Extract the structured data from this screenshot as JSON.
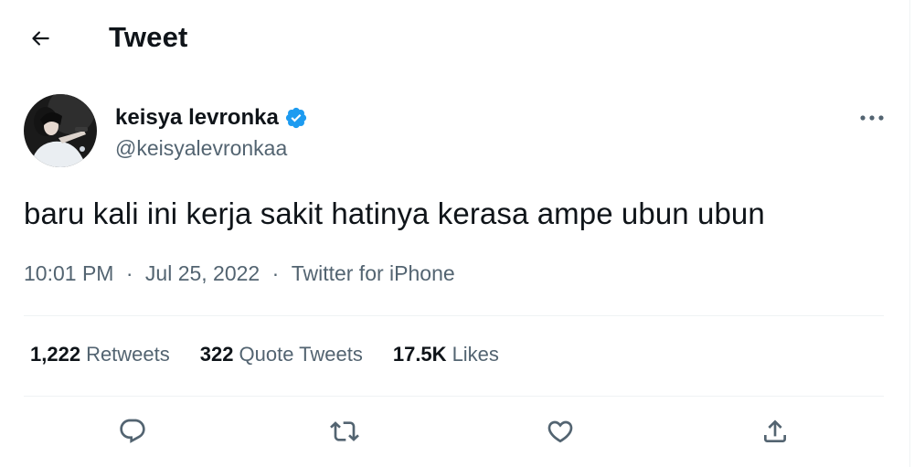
{
  "header": {
    "title": "Tweet",
    "back_icon": "arrow-left-icon"
  },
  "author": {
    "display_name": "keisya levronka",
    "handle": "@keisyalevronkaa",
    "verified": true,
    "verified_color": "#1d9bf0"
  },
  "tweet": {
    "text": "baru kali ini kerja sakit hatinya kerasa ampe ubun ubun",
    "time": "10:01 PM",
    "date": "Jul 25, 2022",
    "source": "Twitter for iPhone",
    "separator": "·"
  },
  "stats": {
    "retweets": {
      "count": "1,222",
      "label": "Retweets"
    },
    "quote_tweets": {
      "count": "322",
      "label": "Quote Tweets"
    },
    "likes": {
      "count": "17.5K",
      "label": "Likes"
    }
  },
  "actions": [
    "reply-icon",
    "retweet-icon",
    "like-icon",
    "share-icon"
  ],
  "colors": {
    "text": "#0f1419",
    "secondary": "#536471",
    "divider": "#eff3f4",
    "accent": "#1d9bf0"
  }
}
